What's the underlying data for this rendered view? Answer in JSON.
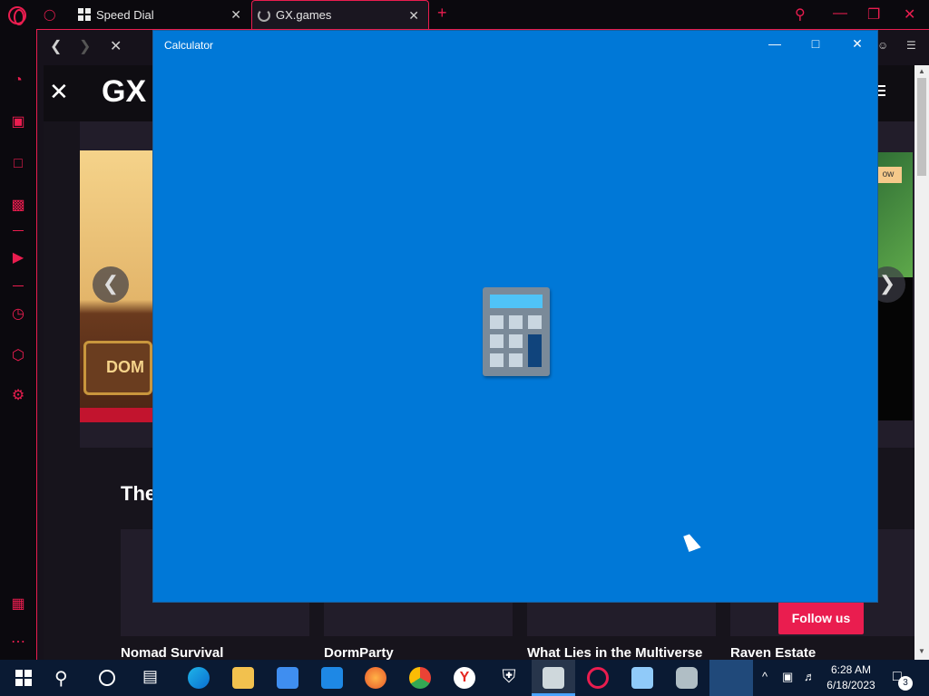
{
  "browser": {
    "tabs": [
      {
        "label": "Speed Dial",
        "icon": "speed-dial-icon"
      },
      {
        "label": "GX.games",
        "icon": "loading-spinner-icon",
        "active": true
      }
    ],
    "accent_color": "#ea1d4f"
  },
  "page": {
    "brand": "GX",
    "section_title": "The",
    "slide_left_text": "DOM",
    "slide_right_tag": "ow",
    "games": [
      {
        "title": "Nomad Survival"
      },
      {
        "title": "DormParty"
      },
      {
        "title": "What Lies in the Multiverse"
      },
      {
        "title": "Raven Estate"
      }
    ],
    "follow_label": "Follow us"
  },
  "calculator": {
    "title": "Calculator",
    "background_color": "#0078d7"
  },
  "taskbar": {
    "time": "6:28 AM",
    "date": "6/18/2023",
    "notification_count": "3"
  }
}
